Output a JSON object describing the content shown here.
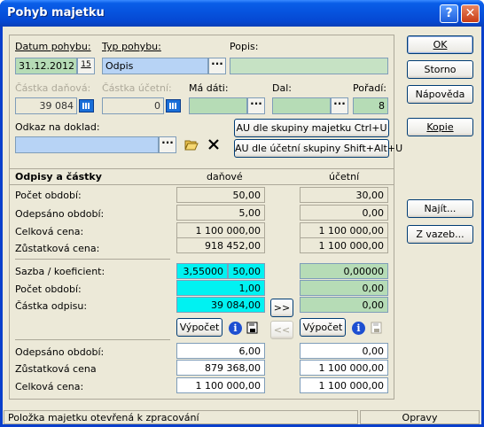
{
  "window": {
    "title": "Pohyb majetku",
    "help_btn": "?",
    "close_btn": "✕"
  },
  "form": {
    "datum_label": "Datum pohybu:",
    "datum_value": "31.12.2012",
    "datum_cal": "15",
    "typ_label": "Typ pohybu:",
    "typ_value": "Odpis",
    "popis_label": "Popis:",
    "popis_value": "",
    "castka_danova_label": "Částka daňová:",
    "castka_danova_value": "39 084",
    "castka_ucetni_label": "Částka účetní:",
    "castka_ucetni_value": "0",
    "ma_dati_label": "Má dáti:",
    "dal_label": "Dal:",
    "poradi_label": "Pořadí:",
    "poradi_value": "8",
    "odkaz_label": "Odkaz na doklad:",
    "odkaz_value": "",
    "dots": "···"
  },
  "buttons": {
    "ok": "OK",
    "storno": "Storno",
    "napoveda": "Nápověda",
    "kopie": "Kopie",
    "najit": "Najít...",
    "z_vazeb": "Z vazeb...",
    "au_majetku": "AU dle skupiny majetku  Ctrl+U",
    "au_ucetni": "AU dle účetní skupiny  Shift+Alt+U",
    "vypocet": "Výpočet",
    "move_right": ">>",
    "move_left": "<<"
  },
  "odpisy": {
    "header": "Odpisy a částky",
    "col_danove": "daňové",
    "col_ucetni": "účetní",
    "rows_top": [
      {
        "label": "Počet období:",
        "danove": "50,00",
        "ucetni": "30,00"
      },
      {
        "label": "Odepsáno období:",
        "danove": "5,00",
        "ucetni": "0,00"
      },
      {
        "label": "Celková cena:",
        "danove": "1 100 000,00",
        "ucetni": "1 100 000,00"
      },
      {
        "label": "Zůstatková cena:",
        "danove": "918 452,00",
        "ucetni": "1 100 000,00"
      }
    ],
    "sazba_label": "Sazba / koeficient:",
    "sazba_danove": "3,55000",
    "koef_danove": "50,00",
    "sazba_ucetni": "0,00000",
    "pocet_obdobi_label": "Počet období:",
    "pocet_obdobi_danove": "1,00",
    "pocet_obdobi_ucetni": "0,00",
    "castka_odpisu_label": "Částka odpisu:",
    "castka_odpisu_danove": "39 084,00",
    "castka_odpisu_ucetni": "0,00",
    "rows_bottom": [
      {
        "label": "Odepsáno období:",
        "danove": "6,00",
        "ucetni": "0,00"
      },
      {
        "label": "Zůstatková cena",
        "danove": "879 368,00",
        "ucetni": "1 100 000,00"
      },
      {
        "label": "Celková cena:",
        "danove": "1 100 000,00",
        "ucetni": "1 100 000,00"
      }
    ]
  },
  "status": {
    "left": "Položka majetku otevřená k zpracování",
    "right": "Opravy"
  },
  "icons": [
    "calendar-icon",
    "calculator-icon",
    "folder-open-icon",
    "delete-x-icon",
    "info-icon",
    "save-icon"
  ]
}
